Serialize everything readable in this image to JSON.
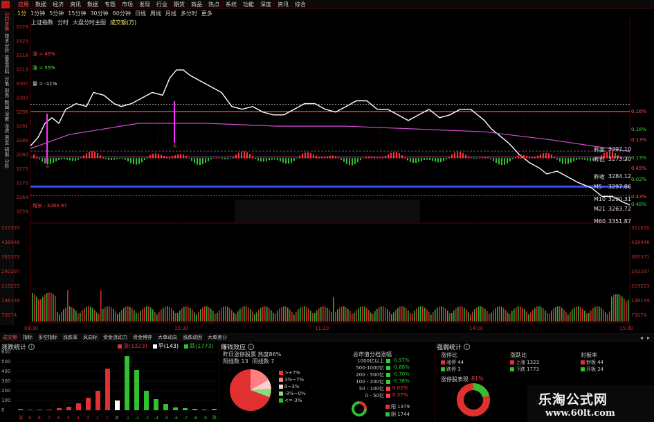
{
  "menu": {
    "items": [
      "应用",
      "数据",
      "经济",
      "资讯",
      "数据",
      "专题",
      "市场",
      "发现",
      "行业",
      "期货",
      "商品",
      "热点",
      "系统",
      "功能",
      "深度",
      "资讯",
      "综合"
    ],
    "active_index": 0
  },
  "periods": {
    "items": [
      "1分",
      "1分钟",
      "5分钟",
      "15分钟",
      "30分钟",
      "60分钟",
      "日线",
      "周线",
      "月线",
      "多分时",
      "更多"
    ],
    "active_index": 0
  },
  "sidebar": {
    "tabs": [
      "分时走势",
      "技术分析",
      "基本资料",
      "分笔",
      "财务",
      "新闻",
      "深度",
      "龙虎",
      "资金",
      "研报",
      "分析"
    ],
    "active_index": 0
  },
  "chart_header": {
    "index_name": "上证指数",
    "mode": "分时",
    "main_chart": "大盘分时主图",
    "volume_label": "成交额(万)"
  },
  "price_axis": {
    "left_ticks": [
      "3329",
      "3323",
      "3318",
      "3313",
      "3307",
      "3302",
      "3296",
      "3291",
      "3286",
      "3280",
      "3275",
      "3270",
      "3264",
      "3259"
    ],
    "right_ticks": [
      "0.16%",
      "0.16%",
      "0.13%",
      "0.13%",
      "0.45%",
      "0.02%",
      "0.43%",
      "0.48%"
    ],
    "left_notes": [
      {
        "label": "涨 = 45%",
        "color": "#ff4040"
      },
      {
        "label": "涨 = 55%",
        "color": "#40ff40"
      },
      {
        "label": "量 = -11%",
        "color": "#e0e0e0"
      }
    ],
    "bottom_note": "增长 : 3264.97"
  },
  "volume_axis": {
    "left_ticks": [
      "511520",
      "438446",
      "365371",
      "292297",
      "219223",
      "146149",
      "73074"
    ],
    "right_ticks": [
      "511520",
      "438446",
      "365371",
      "292297",
      "219223",
      "146149",
      "73074"
    ]
  },
  "time_axis": [
    "09:30",
    "10:30",
    "11:30",
    "14:00",
    "15:00"
  ],
  "right_panel": {
    "rows": [
      {
        "label": "昨高",
        "value": "3297.10"
      },
      {
        "label": "昨低",
        "value": "3273.20"
      },
      {
        "label": "昨收",
        "value": "3284.12"
      },
      {
        "label": "M5",
        "value": "3297.86"
      },
      {
        "label": "M10",
        "value": "3290.31"
      },
      {
        "label": "M21",
        "value": "3263.72"
      },
      {
        "label": "M60",
        "value": "3351.87"
      }
    ]
  },
  "bottom_tabs": {
    "items": [
      "成交额",
      "指标",
      "多空指标",
      "涨跌率",
      "风向标",
      "资金流动力",
      "资金博弈",
      "大单动向",
      "涨跌动因",
      "大单差分"
    ],
    "active_index": 0,
    "nav": [
      "◂",
      "▸"
    ]
  },
  "panel_stats": {
    "title": "涨跌统计",
    "legend": [
      {
        "label": "涨(1323)",
        "color": "#e03030"
      },
      {
        "label": "平(143)",
        "color": "#ffffff"
      },
      {
        "label": "跌(1773)",
        "color": "#30c030"
      }
    ],
    "y_ticks": [
      "600",
      "500",
      "400",
      "300",
      "200",
      "100",
      "0"
    ],
    "x_labels": [
      "涨",
      "9",
      "8",
      "7",
      "6",
      "5",
      "4",
      "3",
      "2",
      "1",
      "0",
      "-1",
      "-2",
      "-3",
      "-4",
      "-5",
      "-6",
      "-7",
      "-8",
      "-9",
      "跌"
    ]
  },
  "panel_money": {
    "title": "赚钱效应",
    "yesterday": "昨日涨停股票 热度86%",
    "stats_a": "阳线数 13",
    "stats_b": "阴线数 7",
    "pie_legend": [
      {
        "label": ">+7%",
        "color": "#ff3030"
      },
      {
        "label": "3%~7%",
        "color": "#ff8080"
      },
      {
        "label": "0~3%",
        "color": "#ffd0d0"
      },
      {
        "label": "-3%~0%",
        "color": "#80e080"
      },
      {
        "label": "<=-3%",
        "color": "#30c030"
      }
    ],
    "cap_title": "总市值分档涨幅",
    "cap_rows": [
      {
        "label": "1000亿以上",
        "value": "-0.97%",
        "color": "#30d030"
      },
      {
        "label": "500-1000亿",
        "value": "-0.68%",
        "color": "#30d030"
      },
      {
        "label": "200 - 500亿",
        "value": "-0.70%",
        "color": "#30d030"
      },
      {
        "label": "100 - 200亿",
        "value": "-0.38%",
        "color": "#30d030"
      },
      {
        "label": "50 - 100亿",
        "value": "0.02%",
        "color": "#ff4040"
      },
      {
        "label": "0 - 50亿",
        "value": "0.37%",
        "color": "#ff4040"
      }
    ],
    "ring_legend": [
      {
        "label": "阳 1379",
        "color": "#e03030"
      },
      {
        "label": "阴 1744",
        "color": "#30c030"
      }
    ]
  },
  "panel_strength": {
    "title": "强弱统计",
    "col1_title": "涨停比",
    "col1_rows": [
      {
        "label": "涨停 44",
        "color": "#e03030"
      },
      {
        "label": "跌停 3",
        "color": "#30c030"
      }
    ],
    "col2_title": "涨跌比",
    "col2_rows": [
      {
        "label": "上涨 1323",
        "color": "#e03030"
      },
      {
        "label": "下跌 1773",
        "color": "#30c030"
      }
    ],
    "col3_title": "封板率",
    "col3_rows": [
      {
        "label": "封板 44",
        "color": "#e03030"
      },
      {
        "label": "开板 24",
        "color": "#30c030"
      }
    ],
    "limitup_perf": "涨停股表现",
    "limitup_value": "81%"
  },
  "watermark": {
    "title": "乐淘公式网",
    "url": "www.60lt.com"
  },
  "chart_data": {
    "type": "line",
    "intraday_minutes": 241,
    "price_ylim": [
      3259,
      3329
    ],
    "volume_ylim": [
      0,
      511520
    ],
    "reference_lines": {
      "prev_close": 3284.12,
      "red_upper": 3298.2,
      "blue_lower": 3271.5,
      "magenta_mid": 3282.0,
      "dashed_top": 3300.8,
      "dashed_bottom": 3268.3
    },
    "price_series": [
      {
        "name": "index",
        "color": "#ffffff"
      },
      {
        "name": "avg",
        "color": "#d050d0"
      }
    ]
  }
}
